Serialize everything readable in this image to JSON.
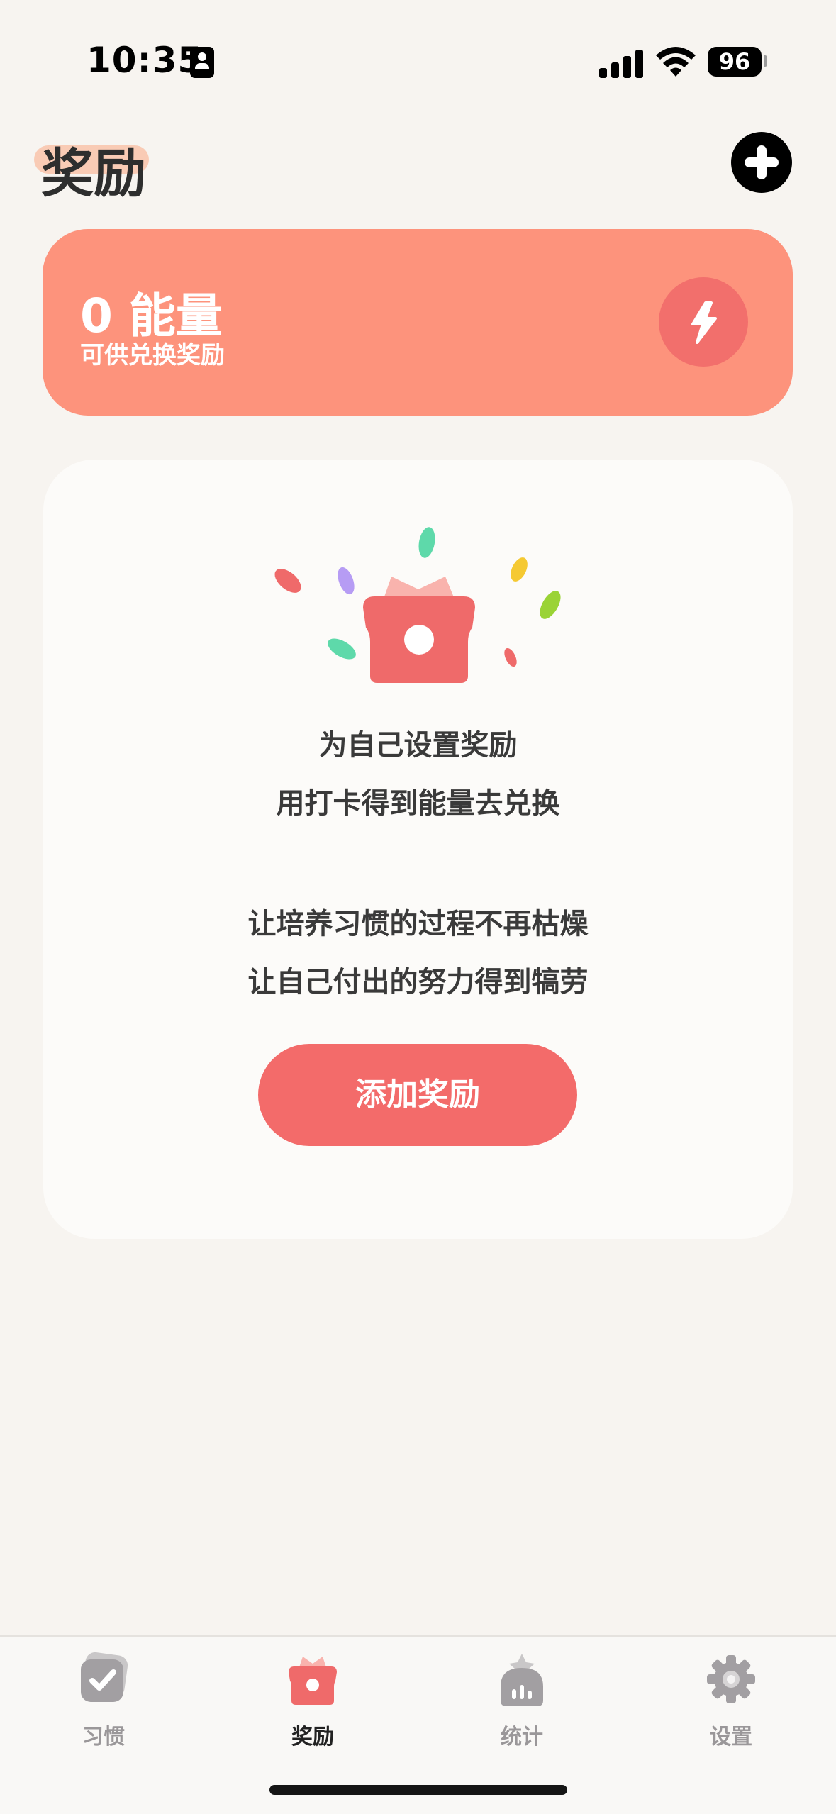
{
  "status_bar": {
    "time": "10:35",
    "battery": "96"
  },
  "header": {
    "title": "奖励"
  },
  "energy": {
    "value": "0 能量",
    "subtitle": "可供兑换奖励",
    "icon": "lightning-icon"
  },
  "empty_state": {
    "line1": "为自己设置奖励",
    "line2": "用打卡得到能量去兑换",
    "line3": "让培养习惯的过程不再枯燥",
    "line4": "让自己付出的努力得到犒劳",
    "button": "添加奖励"
  },
  "tabs": [
    {
      "label": "习惯",
      "icon": "habit-check-icon",
      "active": false
    },
    {
      "label": "奖励",
      "icon": "gift-icon",
      "active": true
    },
    {
      "label": "统计",
      "icon": "stats-icon",
      "active": false
    },
    {
      "label": "设置",
      "icon": "gear-icon",
      "active": false
    }
  ],
  "colors": {
    "background": "#f7f4f0",
    "energy_card": "#fd937c",
    "accent": "#f36b6a",
    "tab_active": "#222222",
    "tab_inactive": "#9a9799"
  }
}
